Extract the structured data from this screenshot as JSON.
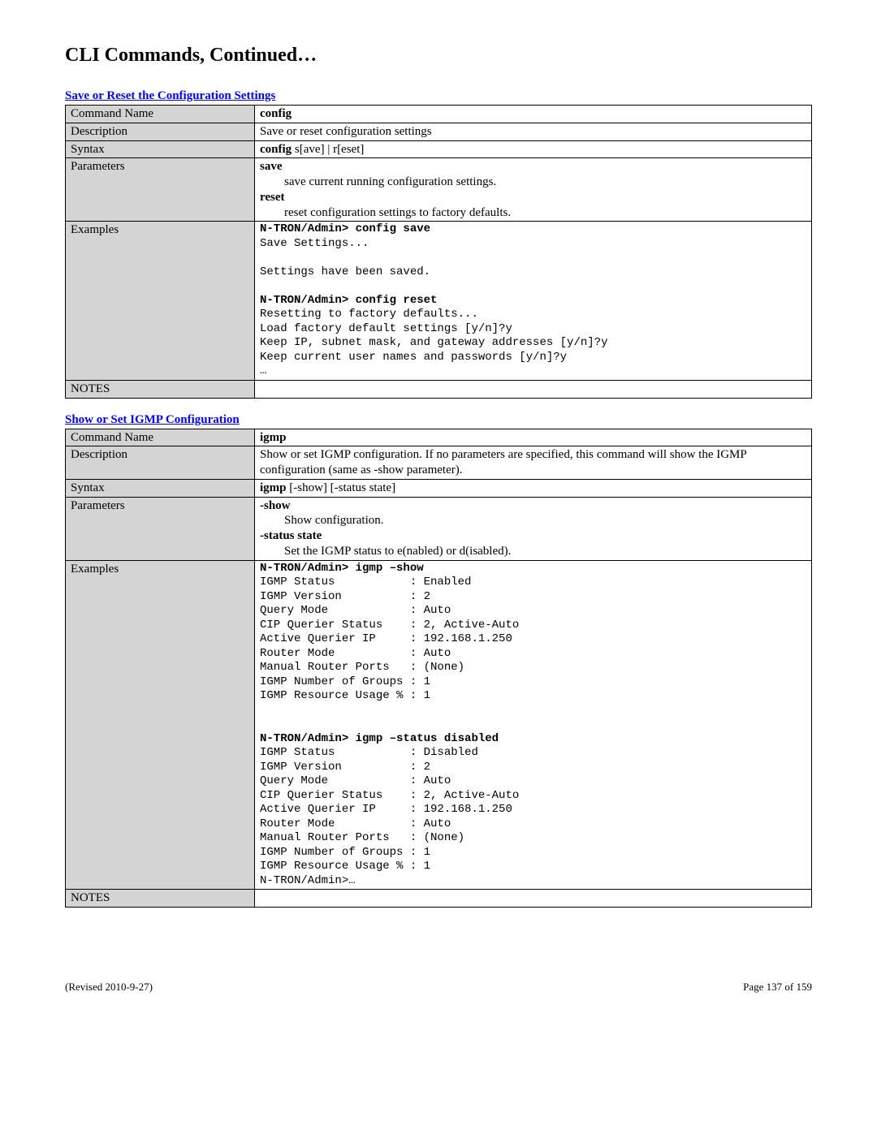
{
  "page_title": "CLI Commands, Continued…",
  "sections": [
    {
      "title": "Save or Reset the Configuration Settings",
      "rows": {
        "command_name_label": "Command Name",
        "command_name_value": "config",
        "description_label": "Description",
        "description_value": "Save or reset configuration settings",
        "syntax_label": "Syntax",
        "syntax_prefix": "config",
        "syntax_rest": " s[ave] | r[eset]",
        "parameters_label": "Parameters",
        "param1_name": "save",
        "param1_desc": "save current running configuration settings.",
        "param2_name": "reset",
        "param2_desc": "reset configuration settings to factory defaults.",
        "examples_label": "Examples",
        "example_cmd1": "N-TRON/Admin> config save",
        "example_body1": "\nSave Settings...\n\nSettings have been saved.\n",
        "example_cmd2": "N-TRON/Admin> config reset",
        "example_body2": "\nResetting to factory defaults...\nLoad factory default settings [y/n]?y\nKeep IP, subnet mask, and gateway addresses [y/n]?y\nKeep current user names and passwords [y/n]?y\n…",
        "notes_label": "NOTES",
        "notes_value": ""
      }
    },
    {
      "title": "Show or Set IGMP Configuration",
      "rows": {
        "command_name_label": "Command Name",
        "command_name_value": "igmp",
        "description_label": "Description",
        "description_value": "Show or set IGMP configuration. If no parameters are specified, this command will show the IGMP configuration (same as -show parameter).",
        "syntax_label": "Syntax",
        "syntax_prefix": "igmp",
        "syntax_rest": " [-show] [-status state]",
        "parameters_label": "Parameters",
        "param1_name": "-show",
        "param1_desc": "Show configuration.",
        "param2_name": "-status state",
        "param2_desc": "Set the IGMP status to e(nabled) or d(isabled).",
        "examples_label": "Examples",
        "example_cmd1": "N-TRON/Admin> igmp –show",
        "example_body1": "\nIGMP Status           : Enabled\nIGMP Version          : 2\nQuery Mode            : Auto\nCIP Querier Status    : 2, Active-Auto\nActive Querier IP     : 192.168.1.250\nRouter Mode           : Auto\nManual Router Ports   : (None)\nIGMP Number of Groups : 1\nIGMP Resource Usage % : 1\n\n",
        "example_cmd2": "N-TRON/Admin> igmp –status disabled",
        "example_body2": "\nIGMP Status           : Disabled\nIGMP Version          : 2\nQuery Mode            : Auto\nCIP Querier Status    : 2, Active-Auto\nActive Querier IP     : 192.168.1.250\nRouter Mode           : Auto\nManual Router Ports   : (None)\nIGMP Number of Groups : 1\nIGMP Resource Usage % : 1\nN-TRON/Admin>…",
        "notes_label": "NOTES",
        "notes_value": ""
      }
    }
  ],
  "footer": {
    "revised": "(Revised 2010-9-27)",
    "page": "Page 137 of 159"
  }
}
